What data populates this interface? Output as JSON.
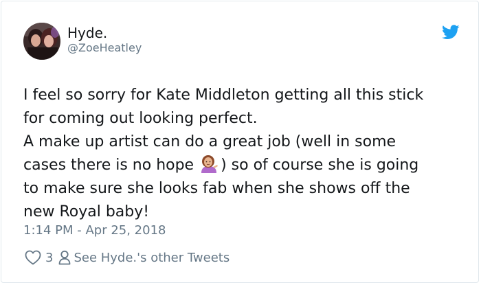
{
  "author": {
    "display_name": "Hyde.",
    "handle": "@ZoeHeatley",
    "avatar_icon": "profile-photo-two-women"
  },
  "tweet": {
    "lines": [
      "I feel so sorry for Kate Middleton getting all this stick",
      "for coming out looking perfect.",
      "A make up artist can do a great job (well in some",
      "cases there is no hope",
      ") so of course she is going",
      "to make sure she looks fab when she shows off the",
      "new Royal baby!"
    ],
    "emoji": "woman-tipping-hand-emoji",
    "timestamp": "1:14 PM - Apr 25, 2018"
  },
  "footer": {
    "like_count": "3",
    "other_tweets_label": "See Hyde.'s other Tweets"
  },
  "colors": {
    "twitter_blue": "#1da1f2",
    "text": "#14171a",
    "secondary": "#657786"
  }
}
